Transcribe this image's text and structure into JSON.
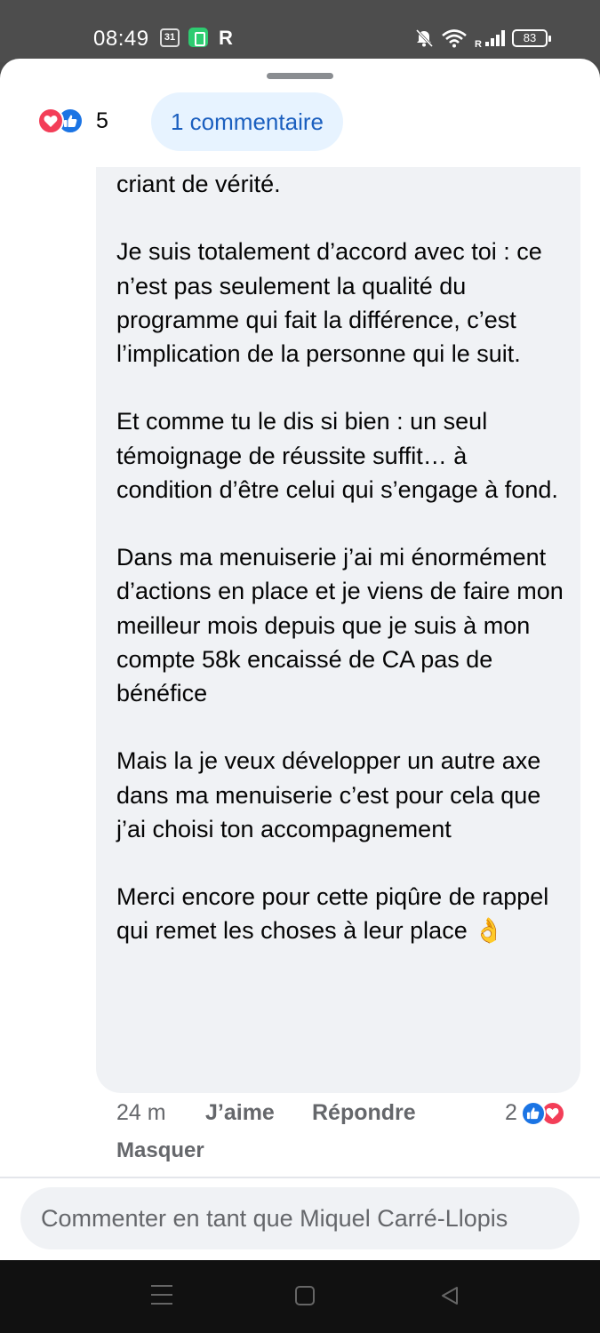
{
  "status_bar": {
    "time": "08:49",
    "calendar_day": "31",
    "r_label": "R",
    "signal_label": "R",
    "battery": "83"
  },
  "sheet": {
    "reaction_count": "5",
    "comments_pill": "1 commentaire"
  },
  "comment": {
    "text": "criant de vérité.\n\nJe suis totalement d’accord avec toi : ce n’est pas seulement la qualité du programme qui fait la différence, c’est l’implication de la personne qui le suit.\n\nEt comme tu le dis si bien : un seul témoignage de réussite suffit… à condition d’être celui qui s’engage à fond.\n\nDans ma menuiserie j’ai mi énormément d’actions en place et je viens de faire mon meilleur mois depuis que je suis à mon compte 58k encaissé de CA pas de bénéfice\n\nMais la je veux développer un autre axe dans ma menuiserie c’est pour cela que j’ai choisi ton accompagnement\n\nMerci encore pour cette piqûre de rappel qui remet les choses à leur place 👌",
    "time": "24 m",
    "like_label": "J’aime",
    "reply_label": "Répondre",
    "hide_label": "Masquer",
    "reaction_count": "2"
  },
  "composer": {
    "placeholder": "Commenter en tant que Miquel Carré-Llopis"
  },
  "colors": {
    "like_blue": "#1b74e4",
    "heart_red": "#f33e58",
    "pill_bg": "#e7f3ff",
    "pill_text": "#1b5fbf",
    "bubble_bg": "#f0f2f5"
  }
}
